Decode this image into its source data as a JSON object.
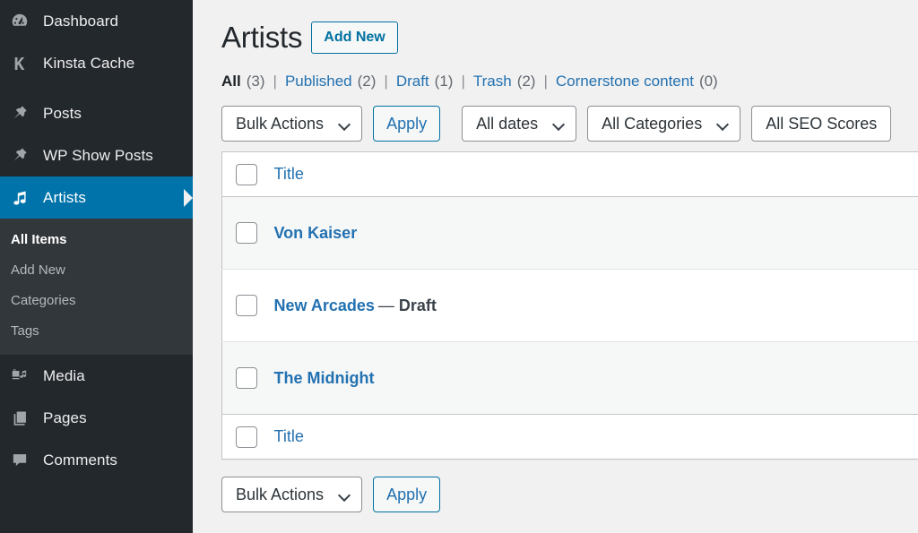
{
  "sidebar": {
    "items": [
      {
        "label": "Dashboard",
        "icon": "dashboard-icon",
        "current": false
      },
      {
        "label": "Kinsta Cache",
        "icon": "kinsta-k-icon",
        "current": false
      },
      {
        "label": "Posts",
        "icon": "pushpin-icon",
        "current": false
      },
      {
        "label": "WP Show Posts",
        "icon": "pushpin-icon",
        "current": false
      },
      {
        "label": "Artists",
        "icon": "music-note-icon",
        "current": true
      }
    ],
    "submenu": [
      {
        "label": "All Items",
        "current": true
      },
      {
        "label": "Add New",
        "current": false
      },
      {
        "label": "Categories",
        "current": false
      },
      {
        "label": "Tags",
        "current": false
      }
    ],
    "items_after": [
      {
        "label": "Media",
        "icon": "media-camera-music-icon",
        "current": false
      },
      {
        "label": "Pages",
        "icon": "pages-icon",
        "current": false
      },
      {
        "label": "Comments",
        "icon": "comment-bubble-icon",
        "current": false
      }
    ]
  },
  "header": {
    "title": "Artists",
    "add_new_label": "Add New"
  },
  "status_nav": [
    {
      "label": "All",
      "count": "(3)",
      "current": true
    },
    {
      "label": "Published",
      "count": "(2)",
      "current": false
    },
    {
      "label": "Draft",
      "count": "(1)",
      "current": false
    },
    {
      "label": "Trash",
      "count": "(2)",
      "current": false
    },
    {
      "label": "Cornerstone content",
      "count": "(0)",
      "current": false
    }
  ],
  "status_nav_separator": "|",
  "tablenav_top": {
    "bulk_actions_value": "Bulk Actions",
    "apply_label": "Apply",
    "dates_value": "All dates",
    "categories_value": "All Categories",
    "seo_scores_value": "All SEO Scores"
  },
  "tablenav_bottom": {
    "bulk_actions_value": "Bulk Actions",
    "apply_label": "Apply"
  },
  "table": {
    "column_title": "Title",
    "rows": [
      {
        "title": "Von Kaiser",
        "state": "",
        "state_dash": "",
        "alternate": true
      },
      {
        "title": "New Arcades",
        "state": "Draft",
        "state_dash": "—",
        "alternate": false
      },
      {
        "title": "The Midnight",
        "state": "",
        "state_dash": "",
        "alternate": true
      }
    ]
  },
  "colors": {
    "sidebar_bg": "#23282d",
    "submenu_bg": "#32373c",
    "accent_blue": "#0073aa",
    "link_blue": "#2271b1",
    "page_bg": "#f1f1f1",
    "row_alt_bg": "#f6f7f7"
  }
}
